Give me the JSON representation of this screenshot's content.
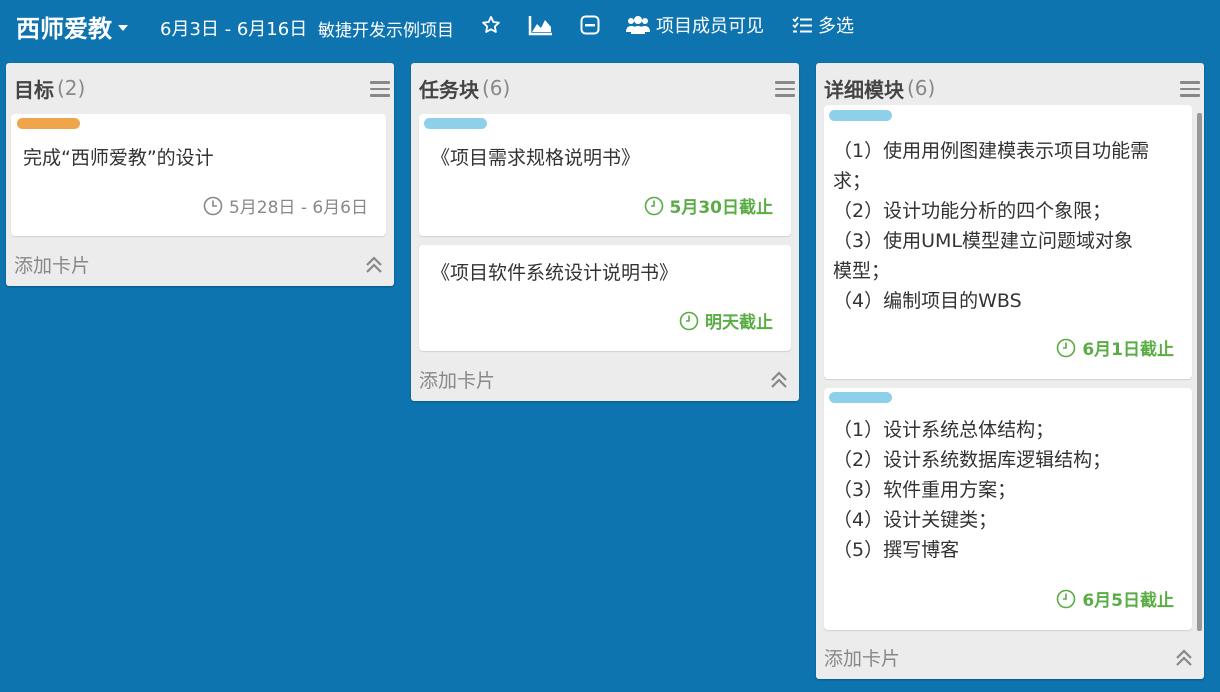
{
  "header": {
    "board_title": "西师爱教",
    "date_range": "6月3日 - 6月16日",
    "project_name": "敏捷开发示例项目",
    "visibility_label": "项目成员可见",
    "multiselect_label": "多选"
  },
  "lists": [
    {
      "name": "目标",
      "count": "(2)",
      "add_label": "添加卡片",
      "cards": [
        {
          "label_color": "#f0a54a",
          "title": "完成“西师爱教”的设计",
          "due": "5月28日 - 6月6日"
        }
      ]
    },
    {
      "name": "任务块",
      "count": "(6)",
      "add_label": "添加卡片",
      "cards": [
        {
          "label_color": "#8ed0ea",
          "title": "《项目需求规格说明书》",
          "due": "5月30日截止"
        },
        {
          "title": "《项目软件系统设计说明书》",
          "due": "明天截止"
        }
      ]
    },
    {
      "name": "详细模块",
      "count": "(6)",
      "add_label": "添加卡片",
      "cards": [
        {
          "label_color": "#8ed0ea",
          "lines": [
            "（1）使用用例图建模表示项目功能需",
            "求；",
            "（2）设计功能分析的四个象限；",
            "（3）使用UML模型建立问题域对象",
            "模型；",
            "（4）编制项目的WBS"
          ],
          "due": "6月1日截止"
        },
        {
          "label_color": "#8ed0ea",
          "lines": [
            "（1）设计系统总体结构；",
            "（2）设计系统数据库逻辑结构；",
            "（3）软件重用方案；",
            "（4）设计关键类；",
            "（5）撰写博客"
          ],
          "due": "6月5日截止"
        }
      ]
    }
  ],
  "colors": {
    "board_bg": "#0e74b0",
    "due_green": "#5aac44"
  }
}
